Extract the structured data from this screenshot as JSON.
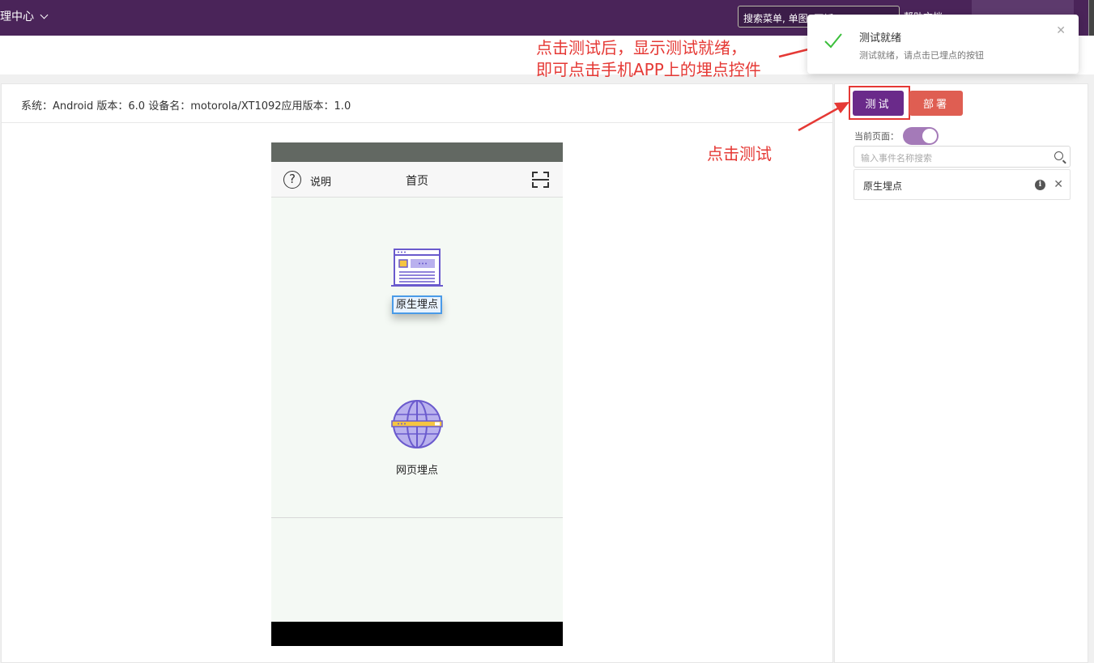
{
  "topbar": {
    "app_title": "理中心",
    "search_value": "搜索菜单, 单图, 页坂",
    "help": "帮助文档"
  },
  "main": {
    "device_info": "系统：Android 版本：6.0 设备名：motorola/XT1092应用版本：1.0"
  },
  "phone": {
    "explain": "说明",
    "home_title": "首页",
    "native_label": "原生埋点",
    "web_label": "网页埋点"
  },
  "sidebar": {
    "test_button": "测试",
    "deploy_button": "部署",
    "current_page_label": "当前页面：",
    "current_page_toggle_on": true,
    "event_search_placeholder": "输入事件名称搜索",
    "events": [
      "原生埋点"
    ]
  },
  "toast": {
    "title": "测试就绪",
    "message": "测试就绪，请点击已埋点的按钮"
  },
  "annotations": {
    "line1": "点击测试后，显示测试就绪，",
    "line2": "即可点击手机APP上的埋点控件",
    "click_test": "点击测试"
  },
  "colors": {
    "topbar": "#4a2459",
    "test_button": "#6a2a8a",
    "deploy_button": "#df5e52",
    "annotation": "#e53935",
    "toast_check": "#3bbf3b"
  }
}
